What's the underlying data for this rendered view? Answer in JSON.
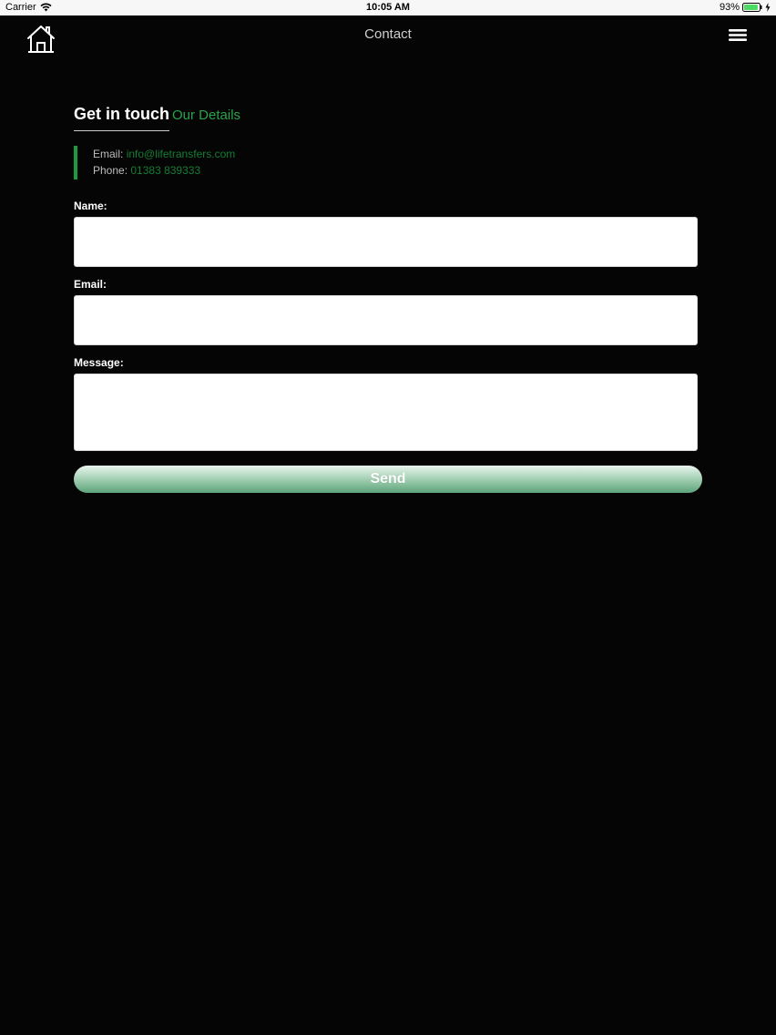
{
  "status_bar": {
    "carrier": "Carrier",
    "time": "10:05 AM",
    "battery_percent": "93%",
    "battery_level": 0.93,
    "battery_color": "#4cd964"
  },
  "nav": {
    "title": "Contact",
    "home_icon": "home-icon",
    "menu_icon": "hamburger-menu-icon"
  },
  "contact": {
    "heading": "Get in touch",
    "subheading": "Our Details",
    "email_label": "Email: ",
    "email_value": "info@lifetransfers.com",
    "phone_label": "Phone: ",
    "phone_value": "01383 839333"
  },
  "form": {
    "name_label": "Name:",
    "name_value": "",
    "email_label": "Email:",
    "email_value": "",
    "message_label": "Message:",
    "message_value": "",
    "send_label": "Send"
  },
  "colors": {
    "accent_green": "#2aa34a",
    "background": "#050505"
  }
}
